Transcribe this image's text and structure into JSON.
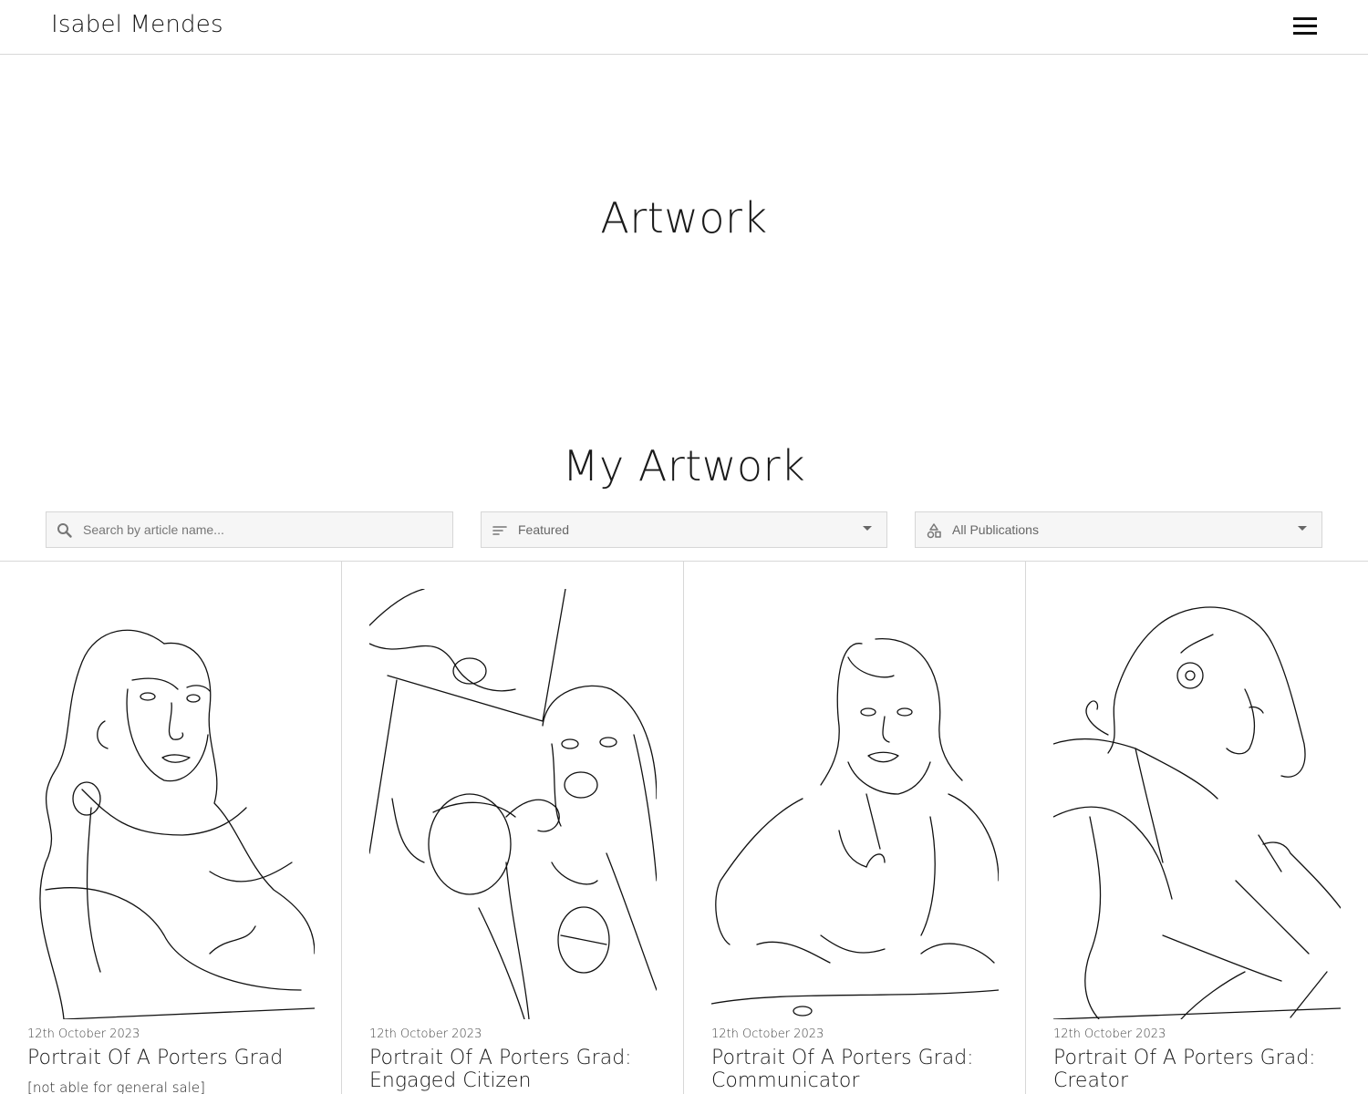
{
  "header": {
    "brand": "Isabel Mendes",
    "menu_icon": "hamburger-menu-icon"
  },
  "hero": {
    "title": "Artwork"
  },
  "section": {
    "title": "My Artwork"
  },
  "filters": {
    "search": {
      "placeholder": "Search by article name...",
      "value": "",
      "icon": "search-icon"
    },
    "sort": {
      "selected": "Featured",
      "icon": "sort-icon"
    },
    "publication": {
      "selected": "All Publications",
      "icon": "category-shapes-icon"
    }
  },
  "articles": [
    {
      "date": "12th October 2023",
      "title": "Portrait Of A Porters Grad",
      "note": "[not able for general sale]"
    },
    {
      "date": "12th October 2023",
      "title": "Portrait Of A Porters Grad: Engaged Citizen"
    },
    {
      "date": "12th October 2023",
      "title": "Portrait Of A Porters Grad: Communicator"
    },
    {
      "date": "12th October 2023",
      "title": "Portrait Of A Porters Grad: Creator"
    }
  ]
}
